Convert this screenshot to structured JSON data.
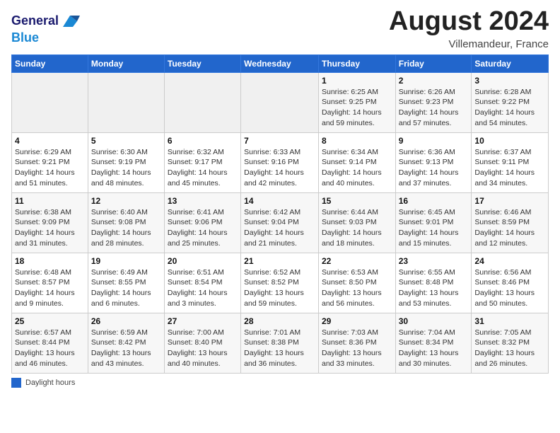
{
  "header": {
    "logo_line1": "General",
    "logo_line2": "Blue",
    "month_year": "August 2024",
    "location": "Villemandeur, France"
  },
  "footer": {
    "legend_label": "Daylight hours"
  },
  "weekdays": [
    "Sunday",
    "Monday",
    "Tuesday",
    "Wednesday",
    "Thursday",
    "Friday",
    "Saturday"
  ],
  "weeks": [
    [
      {
        "day": "",
        "detail": ""
      },
      {
        "day": "",
        "detail": ""
      },
      {
        "day": "",
        "detail": ""
      },
      {
        "day": "",
        "detail": ""
      },
      {
        "day": "1",
        "detail": "Sunrise: 6:25 AM\nSunset: 9:25 PM\nDaylight: 14 hours\nand 59 minutes."
      },
      {
        "day": "2",
        "detail": "Sunrise: 6:26 AM\nSunset: 9:23 PM\nDaylight: 14 hours\nand 57 minutes."
      },
      {
        "day": "3",
        "detail": "Sunrise: 6:28 AM\nSunset: 9:22 PM\nDaylight: 14 hours\nand 54 minutes."
      }
    ],
    [
      {
        "day": "4",
        "detail": "Sunrise: 6:29 AM\nSunset: 9:21 PM\nDaylight: 14 hours\nand 51 minutes."
      },
      {
        "day": "5",
        "detail": "Sunrise: 6:30 AM\nSunset: 9:19 PM\nDaylight: 14 hours\nand 48 minutes."
      },
      {
        "day": "6",
        "detail": "Sunrise: 6:32 AM\nSunset: 9:17 PM\nDaylight: 14 hours\nand 45 minutes."
      },
      {
        "day": "7",
        "detail": "Sunrise: 6:33 AM\nSunset: 9:16 PM\nDaylight: 14 hours\nand 42 minutes."
      },
      {
        "day": "8",
        "detail": "Sunrise: 6:34 AM\nSunset: 9:14 PM\nDaylight: 14 hours\nand 40 minutes."
      },
      {
        "day": "9",
        "detail": "Sunrise: 6:36 AM\nSunset: 9:13 PM\nDaylight: 14 hours\nand 37 minutes."
      },
      {
        "day": "10",
        "detail": "Sunrise: 6:37 AM\nSunset: 9:11 PM\nDaylight: 14 hours\nand 34 minutes."
      }
    ],
    [
      {
        "day": "11",
        "detail": "Sunrise: 6:38 AM\nSunset: 9:09 PM\nDaylight: 14 hours\nand 31 minutes."
      },
      {
        "day": "12",
        "detail": "Sunrise: 6:40 AM\nSunset: 9:08 PM\nDaylight: 14 hours\nand 28 minutes."
      },
      {
        "day": "13",
        "detail": "Sunrise: 6:41 AM\nSunset: 9:06 PM\nDaylight: 14 hours\nand 25 minutes."
      },
      {
        "day": "14",
        "detail": "Sunrise: 6:42 AM\nSunset: 9:04 PM\nDaylight: 14 hours\nand 21 minutes."
      },
      {
        "day": "15",
        "detail": "Sunrise: 6:44 AM\nSunset: 9:03 PM\nDaylight: 14 hours\nand 18 minutes."
      },
      {
        "day": "16",
        "detail": "Sunrise: 6:45 AM\nSunset: 9:01 PM\nDaylight: 14 hours\nand 15 minutes."
      },
      {
        "day": "17",
        "detail": "Sunrise: 6:46 AM\nSunset: 8:59 PM\nDaylight: 14 hours\nand 12 minutes."
      }
    ],
    [
      {
        "day": "18",
        "detail": "Sunrise: 6:48 AM\nSunset: 8:57 PM\nDaylight: 14 hours\nand 9 minutes."
      },
      {
        "day": "19",
        "detail": "Sunrise: 6:49 AM\nSunset: 8:55 PM\nDaylight: 14 hours\nand 6 minutes."
      },
      {
        "day": "20",
        "detail": "Sunrise: 6:51 AM\nSunset: 8:54 PM\nDaylight: 14 hours\nand 3 minutes."
      },
      {
        "day": "21",
        "detail": "Sunrise: 6:52 AM\nSunset: 8:52 PM\nDaylight: 13 hours\nand 59 minutes."
      },
      {
        "day": "22",
        "detail": "Sunrise: 6:53 AM\nSunset: 8:50 PM\nDaylight: 13 hours\nand 56 minutes."
      },
      {
        "day": "23",
        "detail": "Sunrise: 6:55 AM\nSunset: 8:48 PM\nDaylight: 13 hours\nand 53 minutes."
      },
      {
        "day": "24",
        "detail": "Sunrise: 6:56 AM\nSunset: 8:46 PM\nDaylight: 13 hours\nand 50 minutes."
      }
    ],
    [
      {
        "day": "25",
        "detail": "Sunrise: 6:57 AM\nSunset: 8:44 PM\nDaylight: 13 hours\nand 46 minutes."
      },
      {
        "day": "26",
        "detail": "Sunrise: 6:59 AM\nSunset: 8:42 PM\nDaylight: 13 hours\nand 43 minutes."
      },
      {
        "day": "27",
        "detail": "Sunrise: 7:00 AM\nSunset: 8:40 PM\nDaylight: 13 hours\nand 40 minutes."
      },
      {
        "day": "28",
        "detail": "Sunrise: 7:01 AM\nSunset: 8:38 PM\nDaylight: 13 hours\nand 36 minutes."
      },
      {
        "day": "29",
        "detail": "Sunrise: 7:03 AM\nSunset: 8:36 PM\nDaylight: 13 hours\nand 33 minutes."
      },
      {
        "day": "30",
        "detail": "Sunrise: 7:04 AM\nSunset: 8:34 PM\nDaylight: 13 hours\nand 30 minutes."
      },
      {
        "day": "31",
        "detail": "Sunrise: 7:05 AM\nSunset: 8:32 PM\nDaylight: 13 hours\nand 26 minutes."
      }
    ]
  ]
}
